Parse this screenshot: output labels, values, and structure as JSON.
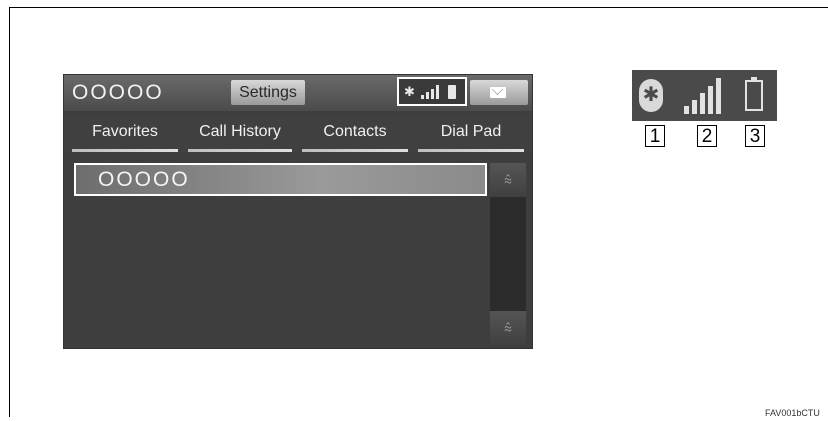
{
  "header": {
    "device_name": "OOOOO",
    "settings_label": "Settings",
    "status": {
      "bluetooth_icon": "bluetooth-icon",
      "signal_icon": "signal-strength-icon",
      "battery_icon": "battery-icon"
    },
    "mail_icon": "envelope-icon"
  },
  "tabs": [
    {
      "label": "Favorites"
    },
    {
      "label": "Call History"
    },
    {
      "label": "Contacts"
    },
    {
      "label": "Dial Pad"
    }
  ],
  "list": {
    "items": [
      {
        "label": "OOOOO"
      }
    ]
  },
  "scroll": {
    "up_icon": "scroll-up-icon",
    "down_icon": "scroll-down-icon"
  },
  "legend": {
    "numbers": [
      "1",
      "2",
      "3"
    ]
  },
  "figure_code": "FAV001bCTU",
  "colors": {
    "screen_bg": "#3e3e3e",
    "highlight": "#ffffff",
    "text": "#f0f0f0"
  }
}
